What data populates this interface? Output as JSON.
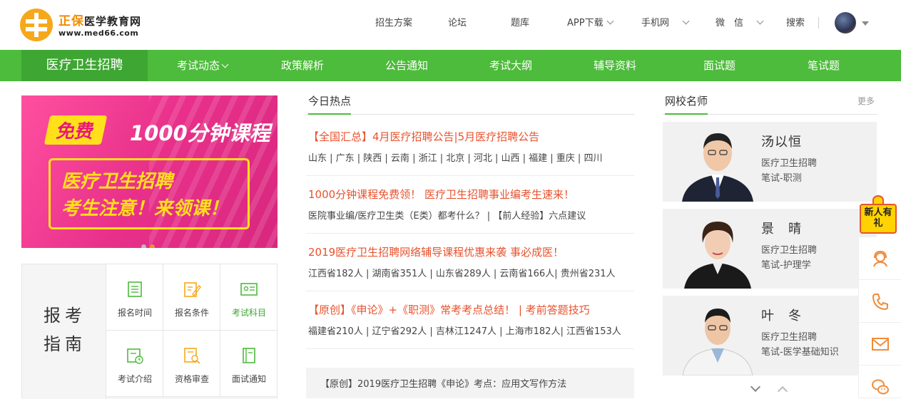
{
  "brand": {
    "name_part1": "正保",
    "name_part2": "医学教育网",
    "url": "www.med66.com"
  },
  "topnav": {
    "items": [
      "招生方案",
      "论坛",
      "题库",
      "APP下载",
      "手机网",
      "微　信",
      "搜索"
    ]
  },
  "mainnav": {
    "home": "医疗卫生招聘",
    "items": [
      "考试动态",
      "政策解析",
      "公告通知",
      "考试大纲",
      "辅导资料",
      "面试题",
      "笔试题"
    ]
  },
  "banner": {
    "free": "免费",
    "minutes": "1000分钟课程",
    "line1": "医疗卫生招聘",
    "line2": "考生注意！来领课！"
  },
  "guide": {
    "title_line1": "报考",
    "title_line2": "指南",
    "cells": [
      "报名时间",
      "报名条件",
      "考试科目",
      "考试介绍",
      "资格审查",
      "面试通知"
    ]
  },
  "hot": {
    "title": "今日热点",
    "news": [
      {
        "headline": "【全国汇总】4月医疗招聘公告|5月医疗招聘公告",
        "sub": "山东 | 广东 | 陕西 | 云南 | 浙江 | 北京 | 河北 | 山西 | 福建 | 重庆 | 四川"
      },
      {
        "headline": "1000分钟课程免费领！ 医疗卫生招聘事业编考生速来！",
        "sub": "医院事业编/医疗卫生类（E类）都考什么？ | 【前人经验】六点建议"
      },
      {
        "headline": "2019医疗卫生招聘网络辅导课程优惠来袭 事必成医！",
        "sub": "江西省182人 | 湖南省351人 | 山东省289人 | 云南省166人| 贵州省231人"
      },
      {
        "headline": "【原创】《申论》+《职测》常考考点总结！ | 考前答题技巧",
        "sub": "福建省210人 | 辽宁省292人 | 吉林江1247人 | 上海市182人| 江西省153人"
      }
    ],
    "bottom": "【原创】2019医疗卫生招聘《申论》考点：应用文写作方法"
  },
  "teachers": {
    "title": "网校名师",
    "more": "更多",
    "list": [
      {
        "name": "汤以恒",
        "role": "医疗卫生招聘",
        "subject": "笔试-职测"
      },
      {
        "name": "景　晴",
        "role": "医疗卫生招聘",
        "subject": "笔试-护理学"
      },
      {
        "name": "叶　冬",
        "role": "医疗卫生招聘",
        "subject": "笔试-医学基础知识"
      }
    ]
  },
  "floatbar": {
    "gift": "新人有礼"
  },
  "colors": {
    "green": "#4dbb3b",
    "dark_green": "#3ea632",
    "orange": "#f08c00",
    "red_text": "#e8522e",
    "banner_pink": "#e8308a"
  }
}
